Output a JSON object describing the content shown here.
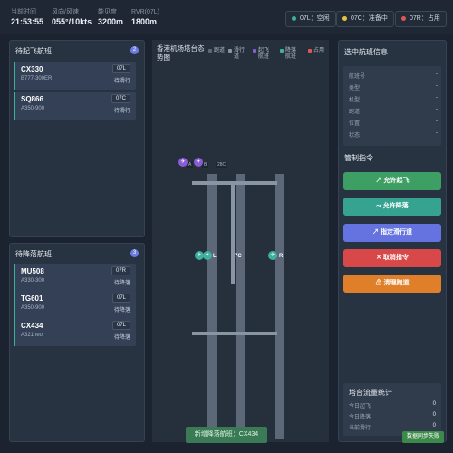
{
  "header": {
    "stats": [
      {
        "label": "当前时间",
        "value": "21:53:55"
      },
      {
        "label": "风向/风速",
        "value": "055°/10kts"
      },
      {
        "label": "能见度",
        "value": "3200m"
      },
      {
        "label": "RVR(07L)",
        "value": "1800m"
      }
    ],
    "runways": [
      {
        "text": "07L：空闲",
        "color": "#3fb0a0"
      },
      {
        "text": "07C：准备中",
        "color": "#e6c440"
      },
      {
        "text": "07R：占用",
        "color": "#e05555"
      }
    ]
  },
  "departures": {
    "title": "待起飞航班",
    "count": "2",
    "flights": [
      {
        "code": "CX330",
        "type": "B777-300ER",
        "runway": "07L",
        "status": "待滑行"
      },
      {
        "code": "SQ866",
        "type": "A350-900",
        "runway": "07C",
        "status": "待滑行"
      }
    ]
  },
  "arrivals": {
    "title": "待降落航班",
    "count": "3",
    "flights": [
      {
        "code": "MU508",
        "type": "A330-300",
        "runway": "07R",
        "status": "待降落"
      },
      {
        "code": "TG601",
        "type": "A350-900",
        "runway": "07L",
        "status": "待降落"
      },
      {
        "code": "CX434",
        "type": "A321neo",
        "runway": "07L",
        "status": "待降落"
      }
    ]
  },
  "map": {
    "title": "香港机场塔台态势图",
    "legend": [
      {
        "label": "跑道",
        "color": "#5c6878"
      },
      {
        "label": "滑行道",
        "color": "#8a95a3"
      },
      {
        "label": "起飞航班",
        "color": "#8a5cd6"
      },
      {
        "label": "降落航班",
        "color": "#3fb0a0"
      },
      {
        "label": "占用",
        "color": "#e05555"
      }
    ],
    "gates": [
      "A",
      "B",
      "28C"
    ],
    "runway_labels": [
      "L",
      "7C",
      "R"
    ]
  },
  "selected": {
    "title": "选中航班信息",
    "rows": [
      {
        "label": "航班号",
        "value": "-"
      },
      {
        "label": "类型",
        "value": "-"
      },
      {
        "label": "机型",
        "value": "-"
      },
      {
        "label": "跑道",
        "value": "-"
      },
      {
        "label": "位置",
        "value": "-"
      },
      {
        "label": "状态",
        "value": "-"
      }
    ]
  },
  "commands": {
    "title": "管制指令",
    "buttons": [
      {
        "label": "↗ 允许起飞",
        "color": "#3d9f63"
      },
      {
        "label": "⤳ 允许降落",
        "color": "#36a391"
      },
      {
        "label": "↗ 指定滑行道",
        "color": "#6473e0"
      },
      {
        "label": "✕ 取消指令",
        "color": "#d94848"
      },
      {
        "label": "⚠ 清理跑道",
        "color": "#e07f2a"
      }
    ]
  },
  "traffic": {
    "title": "塔台流量统计",
    "rows": [
      {
        "label": "今日起飞",
        "value": "0"
      },
      {
        "label": "今日降落",
        "value": "0"
      },
      {
        "label": "当前滑行",
        "value": "0"
      }
    ]
  },
  "toast": "新增降落航班：CX434",
  "sync_error": "数据同步失败"
}
